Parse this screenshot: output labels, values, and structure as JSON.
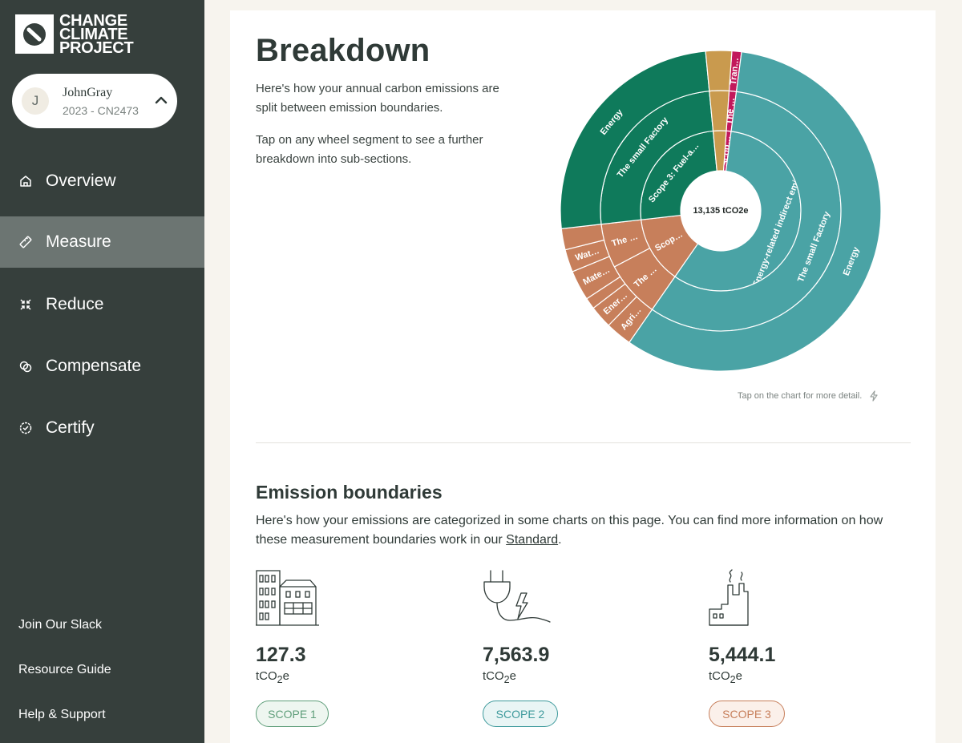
{
  "brand": {
    "line1": "CHANGE",
    "line2": "CLIMATE",
    "line3": "PROJECT"
  },
  "account": {
    "initial": "J",
    "name": "JohnGray",
    "sub": "2023 - CN2473"
  },
  "nav": [
    {
      "label": "Overview",
      "icon": "home-icon"
    },
    {
      "label": "Measure",
      "icon": "ruler-icon",
      "active": true
    },
    {
      "label": "Reduce",
      "icon": "reduce-arrows-icon"
    },
    {
      "label": "Compensate",
      "icon": "circles-icon"
    },
    {
      "label": "Certify",
      "icon": "badge-check-icon"
    }
  ],
  "footer_links": [
    "Join Our Slack",
    "Resource Guide",
    "Help & Support"
  ],
  "breakdown": {
    "title": "Breakdown",
    "para1": "Here's how your annual carbon emissions are split between emission boundaries.",
    "para2": "Tap on any wheel segment to see a further breakdown into sub-sections.",
    "tap_note": "Tap on the chart for more detail."
  },
  "chart_data": {
    "type": "sunburst",
    "center_label": "13,135 tCO2e",
    "total": 13135,
    "colors": {
      "scope1": "#c2185b",
      "scope2": "#4aa3a5",
      "scope3_orange": "#c77f5b",
      "scope3_green": "#0f7a5b",
      "scope3_tan": "#c99a4e"
    },
    "inner_ring": [
      {
        "label": "Scop…",
        "value": 127.3,
        "color": "#c2185b"
      },
      {
        "label": "Scope 2: Energy-related indirect emissions (…",
        "value": 7563.9,
        "color": "#4aa3a5"
      },
      {
        "label": "Scop…",
        "value": 1780,
        "color": "#c77f5b"
      },
      {
        "label": "Scope 3: Fuel-a…",
        "value": 3320,
        "color": "#0f7a5b"
      },
      {
        "label": "",
        "value": 344,
        "color": "#c99a4e"
      }
    ],
    "middle_ring": [
      {
        "label": "The …",
        "value": 127.3,
        "color": "#c2185b"
      },
      {
        "label": "The small Factory",
        "value": 7563.9,
        "color": "#4aa3a5"
      },
      {
        "label": "The …",
        "value": 1000,
        "color": "#c77f5b"
      },
      {
        "label": "The …",
        "value": 780,
        "color": "#c77f5b"
      },
      {
        "label": "The small Factory",
        "value": 3320,
        "color": "#0f7a5b"
      },
      {
        "label": "",
        "value": 344,
        "color": "#c99a4e"
      }
    ],
    "outer_ring": [
      {
        "label": "Tran…",
        "value": 127.3,
        "color": "#c2185b"
      },
      {
        "label": "Energy",
        "value": 7563.9,
        "color": "#4aa3a5"
      },
      {
        "label": "Agri…",
        "value": 350,
        "color": "#c77f5b"
      },
      {
        "label": "Ener…",
        "value": 300,
        "color": "#c77f5b"
      },
      {
        "label": "",
        "value": 150,
        "color": "#c77f5b"
      },
      {
        "label": "Mate…",
        "value": 400,
        "color": "#c77f5b"
      },
      {
        "label": "Wat…",
        "value": 300,
        "color": "#c77f5b"
      },
      {
        "label": "",
        "value": 280,
        "color": "#c77f5b"
      },
      {
        "label": "Energy",
        "value": 3320,
        "color": "#0f7a5b"
      },
      {
        "label": "",
        "value": 344,
        "color": "#c99a4e"
      }
    ]
  },
  "boundaries": {
    "title": "Emission boundaries",
    "desc": "Here's how your emissions are categorized in some charts on this page. You can find more information on how these measurement boundaries work in our ",
    "link": "Standard",
    "desc_end": ".",
    "scopes": [
      {
        "value": "127.3",
        "unit_a": "tCO",
        "unit_sub": "2",
        "unit_b": "e",
        "badge": "SCOPE 1",
        "icon": "buildings-icon",
        "badge_color": "#5f9e7a",
        "badge_bg": "#eef6f0"
      },
      {
        "value": "7,563.9",
        "unit_a": "tCO",
        "unit_sub": "2",
        "unit_b": "e",
        "badge": "SCOPE 2",
        "icon": "plug-icon",
        "badge_color": "#3e9a9c",
        "badge_bg": "#e9f5f5"
      },
      {
        "value": "5,444.1",
        "unit_a": "tCO",
        "unit_sub": "2",
        "unit_b": "e",
        "badge": "SCOPE 3",
        "icon": "factory-icon",
        "badge_color": "#c77f5b",
        "badge_bg": "#fbf0ea"
      }
    ]
  }
}
